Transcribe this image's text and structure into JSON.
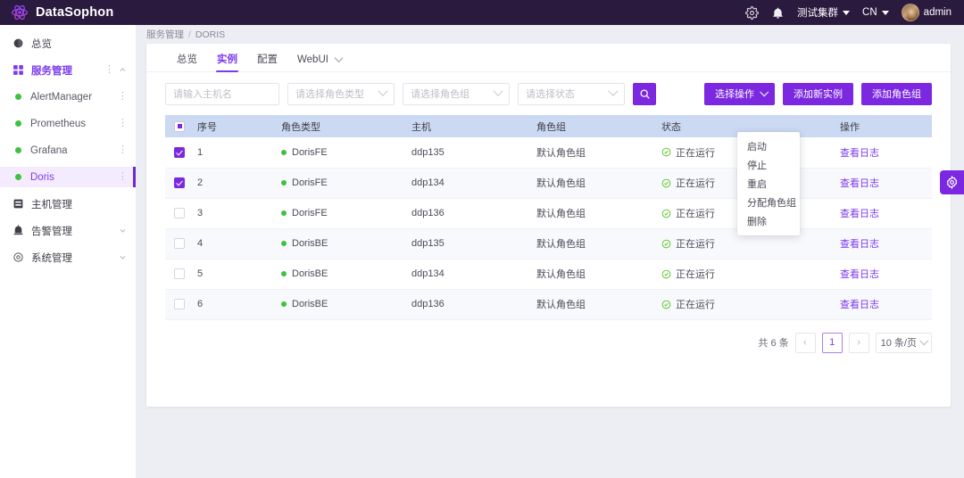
{
  "app": {
    "brand": "DataSophon",
    "logo_icon": "atom-logo-icon"
  },
  "header": {
    "settings_icon": "gear-icon",
    "alarm_icon": "bell-alarm-icon",
    "cluster_label": "测试集群",
    "lang_label": "CN",
    "user_label": "admin",
    "avatar_icon": "avatar"
  },
  "sidebar": {
    "items": [
      {
        "label": "总览",
        "icon": "dashboard-icon",
        "type": "top"
      },
      {
        "label": "服务管理",
        "icon": "grid-icon",
        "type": "top",
        "active_parent": true,
        "more_icon": "more-vertical-icon",
        "chevron": "chevron-up-icon"
      },
      {
        "label": "AlertManager",
        "icon": "status-dot",
        "type": "child",
        "more_icon": "more-vertical-icon"
      },
      {
        "label": "Prometheus",
        "icon": "status-dot",
        "type": "child",
        "more_icon": "more-vertical-icon"
      },
      {
        "label": "Grafana",
        "icon": "status-dot",
        "type": "child",
        "more_icon": "more-vertical-icon"
      },
      {
        "label": "Doris",
        "icon": "status-dot",
        "type": "child",
        "active": true,
        "more_icon": "more-vertical-icon"
      },
      {
        "label": "主机管理",
        "icon": "server-icon",
        "type": "top"
      },
      {
        "label": "告警管理",
        "icon": "alarm-icon",
        "type": "top",
        "chevron": "chevron-down-icon"
      },
      {
        "label": "系统管理",
        "icon": "settings-gear-icon",
        "type": "top",
        "chevron": "chevron-down-icon"
      }
    ]
  },
  "breadcrumb": {
    "parent": "服务管理",
    "separator": "/",
    "current": "DORIS"
  },
  "tabs": [
    {
      "label": "总览",
      "active": false
    },
    {
      "label": "实例",
      "active": true
    },
    {
      "label": "配置",
      "active": false
    },
    {
      "label": "WebUI",
      "active": false,
      "caret": true
    }
  ],
  "toolbar": {
    "host_placeholder": "请输入主机名",
    "host_value": "",
    "role_type_placeholder": "请选择角色类型",
    "role_group_placeholder": "请选择角色组",
    "status_placeholder": "请选择状态",
    "search_icon": "search-icon",
    "select_action_label": "选择操作",
    "add_instance_label": "添加新实例",
    "add_role_group_label": "添加角色组"
  },
  "action_menu": {
    "open": true,
    "items": [
      "启动",
      "停止",
      "重启",
      "分配角色组",
      "删除"
    ]
  },
  "table": {
    "select_all_state": "indeterminate",
    "columns": [
      "序号",
      "角色类型",
      "主机",
      "角色组",
      "状态",
      "操作"
    ],
    "rows": [
      {
        "checked": true,
        "index": "1",
        "role_type": "DorisFE",
        "host": "ddp135",
        "role_group": "默认角色组",
        "status": "正在运行",
        "action": "查看日志"
      },
      {
        "checked": true,
        "index": "2",
        "role_type": "DorisFE",
        "host": "ddp134",
        "role_group": "默认角色组",
        "status": "正在运行",
        "action": "查看日志"
      },
      {
        "checked": false,
        "index": "3",
        "role_type": "DorisFE",
        "host": "ddp136",
        "role_group": "默认角色组",
        "status": "正在运行",
        "action": "查看日志"
      },
      {
        "checked": false,
        "index": "4",
        "role_type": "DorisBE",
        "host": "ddp135",
        "role_group": "默认角色组",
        "status": "正在运行",
        "action": "查看日志"
      },
      {
        "checked": false,
        "index": "5",
        "role_type": "DorisBE",
        "host": "ddp134",
        "role_group": "默认角色组",
        "status": "正在运行",
        "action": "查看日志"
      },
      {
        "checked": false,
        "index": "6",
        "role_type": "DorisBE",
        "host": "ddp136",
        "role_group": "默认角色组",
        "status": "正在运行",
        "action": "查看日志"
      }
    ]
  },
  "pagination": {
    "total_label": "共 6 条",
    "prev_icon": "chevron-left-icon",
    "current_page": "1",
    "next_icon": "chevron-right-icon",
    "page_size_label": "10 条/页"
  },
  "floating": {
    "settings_icon": "gear-icon"
  },
  "colors": {
    "brand_purple": "#7c28e0",
    "accent_purple": "#7c3aed",
    "header_bg": "#2a1a3e",
    "table_head_bg": "#ccd9f2",
    "status_green": "#3ec13e",
    "page_bg": "#eceef3"
  }
}
